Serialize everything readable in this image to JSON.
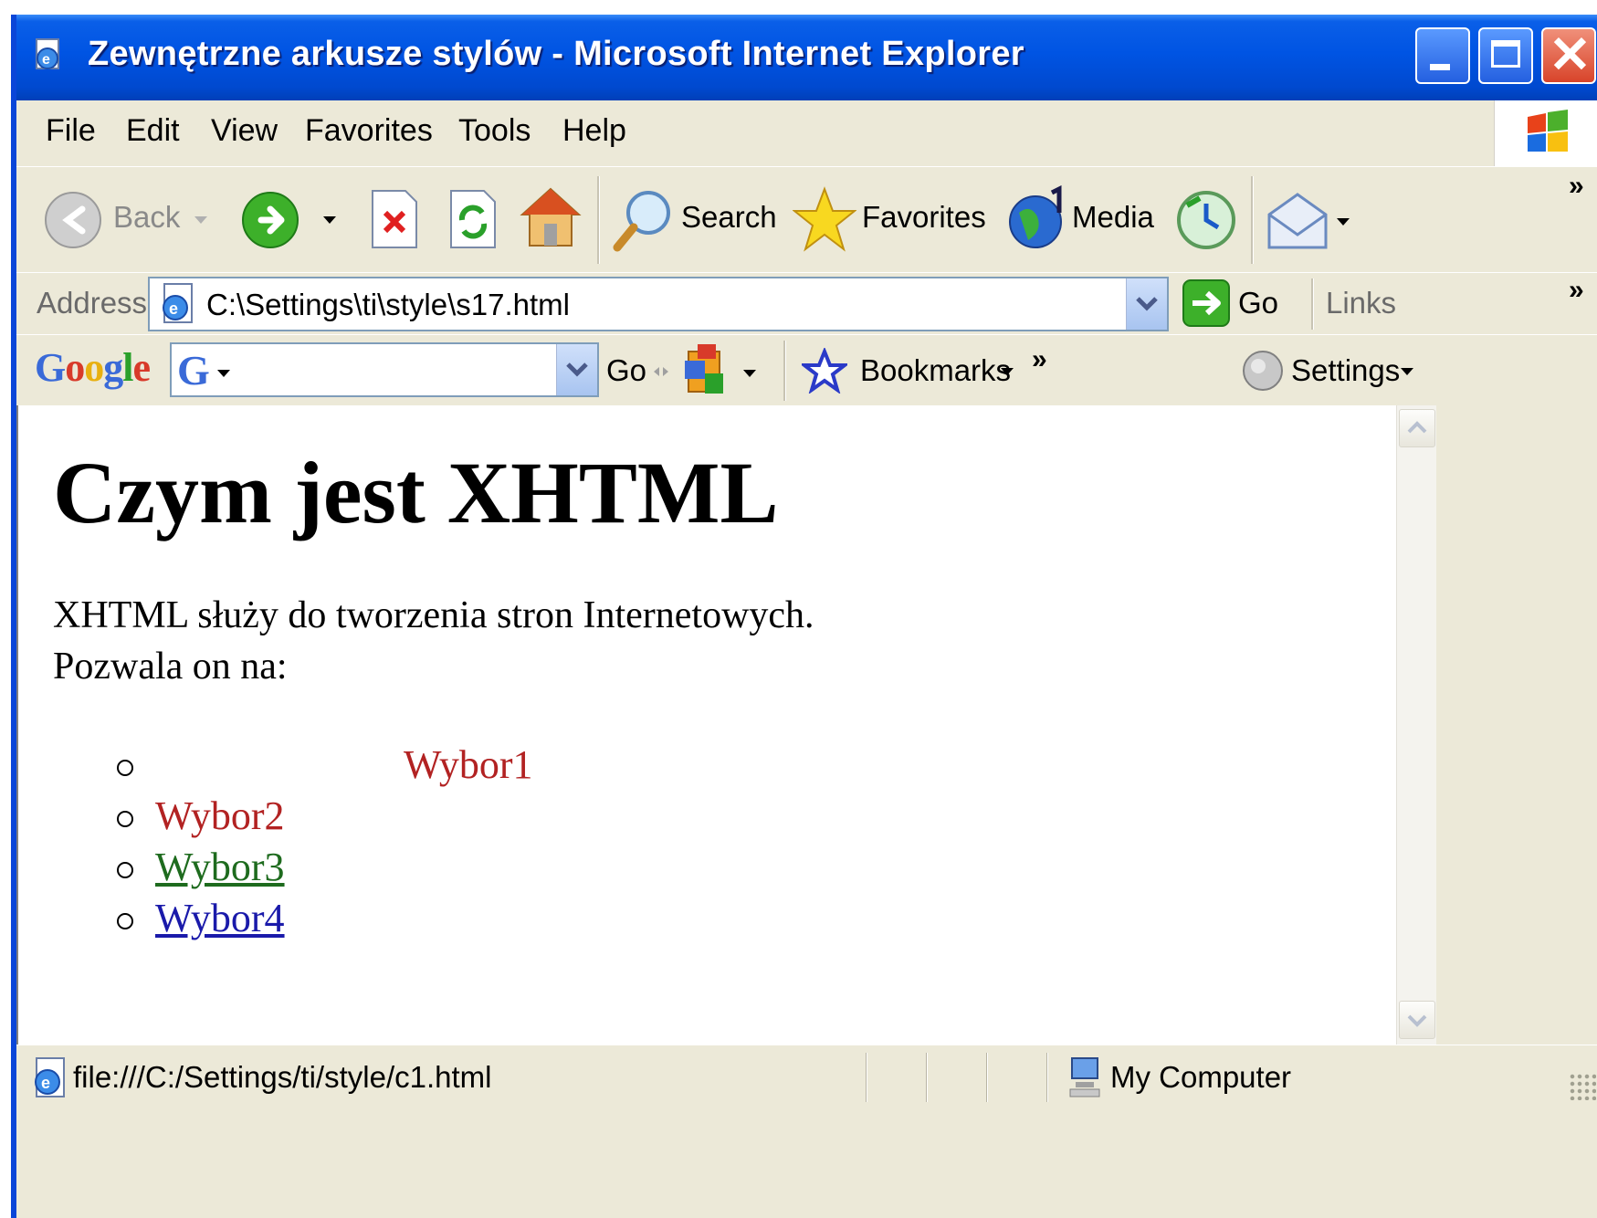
{
  "window": {
    "title": "Zewnętrzne arkusze stylów - Microsoft Internet Explorer"
  },
  "menu": {
    "items": [
      "File",
      "Edit",
      "View",
      "Favorites",
      "Tools",
      "Help"
    ]
  },
  "toolbar": {
    "back_label": "Back",
    "search_label": "Search",
    "favorites_label": "Favorites",
    "media_label": "Media"
  },
  "address": {
    "label": "Address",
    "url": "C:\\Settings\\ti\\style\\s17.html",
    "go_label": "Go",
    "links_label": "Links"
  },
  "google_toolbar": {
    "logo": "Google",
    "go_label": "Go",
    "bookmarks_label": "Bookmarks",
    "settings_label": "Settings"
  },
  "page": {
    "heading": "Czym jest XHTML",
    "paragraph_line1": "XHTML służy do tworzenia stron Internetowych.",
    "paragraph_line2": "Pozwala on na:",
    "list": [
      {
        "label": "Wybor1",
        "color": "#B22222"
      },
      {
        "label": "Wybor2",
        "color": "#B22222"
      },
      {
        "label": "Wybor3",
        "color": "#1E6B1E"
      },
      {
        "label": "Wybor4",
        "color": "#1A1AAA"
      }
    ]
  },
  "status": {
    "text": "file:///C:/Settings/ti/style/c1.html",
    "zone": "My Computer"
  }
}
